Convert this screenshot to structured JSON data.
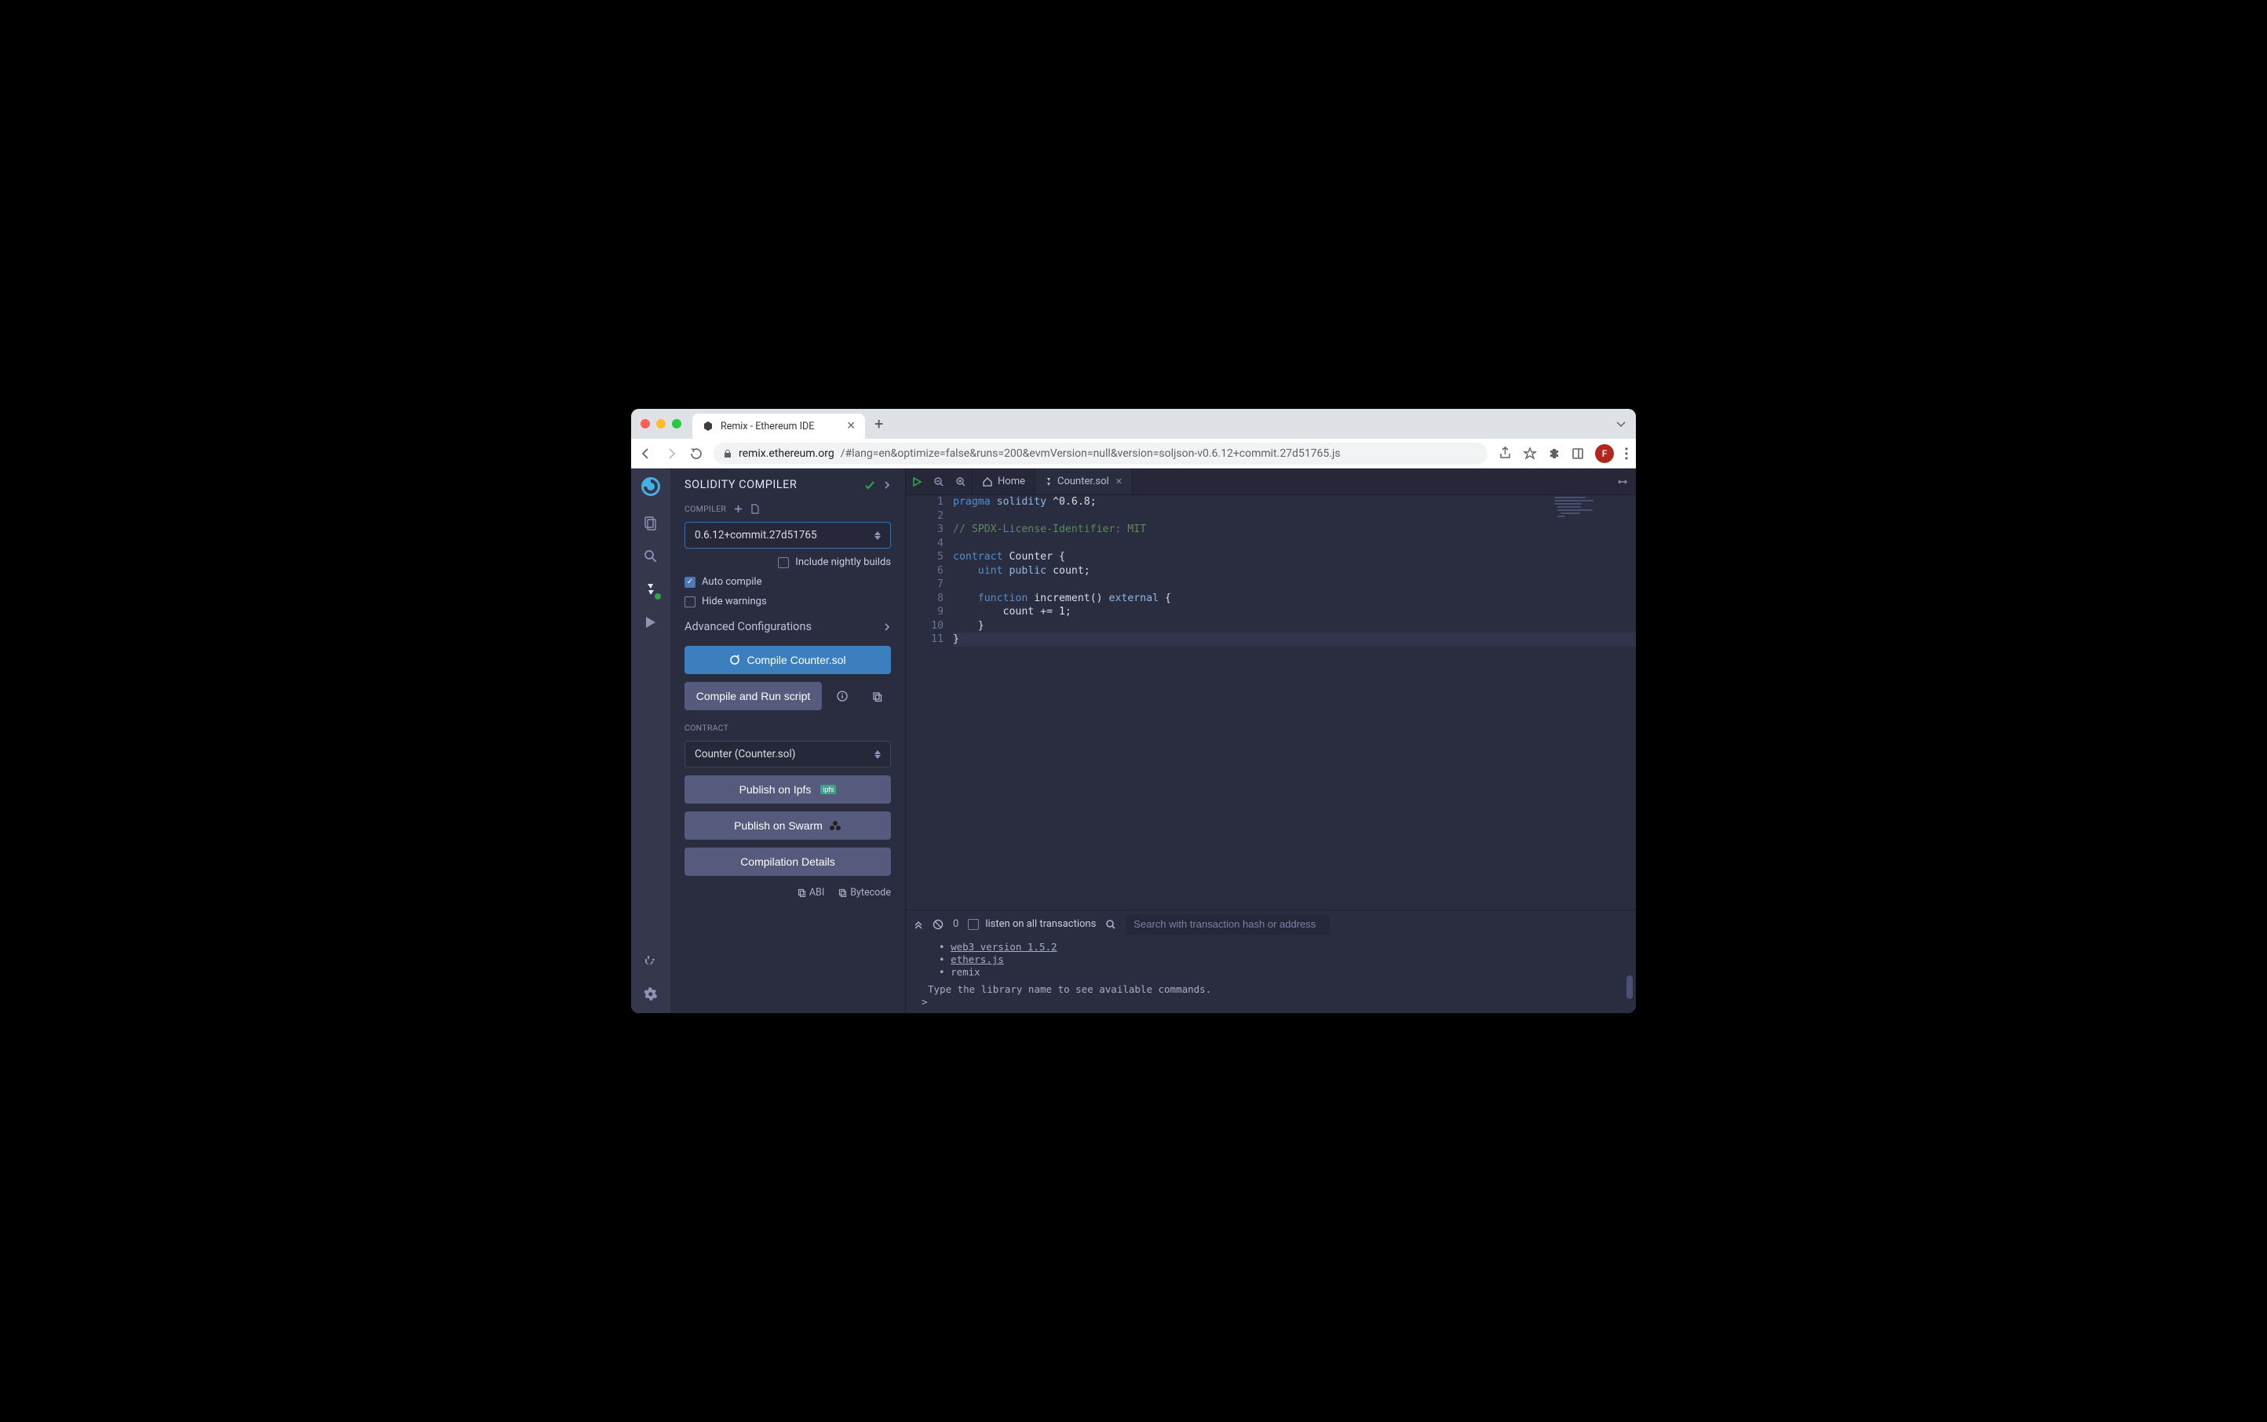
{
  "browser": {
    "tab_title": "Remix - Ethereum IDE",
    "url_host": "remix.ethereum.org",
    "url_path": "/#lang=en&optimize=false&runs=200&evmVersion=null&version=soljson-v0.6.12+commit.27d51765.js",
    "avatar_letter": "F"
  },
  "panel": {
    "title": "SOLIDITY COMPILER",
    "compiler_label": "COMPILER",
    "compiler_value": "0.6.12+commit.27d51765",
    "nightly_label": "Include nightly builds",
    "autocompile_label": "Auto compile",
    "hidewarnings_label": "Hide warnings",
    "adv_label": "Advanced Configurations",
    "compile_btn": "Compile Counter.sol",
    "compile_run_btn": "Compile and Run script",
    "contract_label": "CONTRACT",
    "contract_value": "Counter (Counter.sol)",
    "publish_ipfs": "Publish on Ipfs",
    "publish_swarm": "Publish on Swarm",
    "compilation_details": "Compilation Details",
    "abi_label": "ABI",
    "bytecode_label": "Bytecode",
    "ipfs_badge": "ipfs"
  },
  "editor": {
    "home_tab": "Home",
    "active_tab": "Counter.sol",
    "lines": [
      {
        "n": 1,
        "tokens": [
          {
            "c": "k1",
            "t": "pragma"
          },
          {
            "t": " "
          },
          {
            "c": "k2",
            "t": "solidity"
          },
          {
            "t": " ^0.6.8;"
          }
        ]
      },
      {
        "n": 2,
        "tokens": []
      },
      {
        "n": 3,
        "tokens": [
          {
            "c": "cmt",
            "t": "// SPDX-License-Identifier: MIT"
          }
        ]
      },
      {
        "n": 4,
        "tokens": []
      },
      {
        "n": 5,
        "tokens": [
          {
            "c": "k1",
            "t": "contract"
          },
          {
            "t": " Counter {"
          }
        ]
      },
      {
        "n": 6,
        "tokens": [
          {
            "t": "    "
          },
          {
            "c": "k1",
            "t": "uint"
          },
          {
            "t": " "
          },
          {
            "c": "k2",
            "t": "public"
          },
          {
            "t": " count;"
          }
        ]
      },
      {
        "n": 7,
        "tokens": []
      },
      {
        "n": 8,
        "tokens": [
          {
            "t": "    "
          },
          {
            "c": "k1",
            "t": "function"
          },
          {
            "t": " increment() "
          },
          {
            "c": "k2",
            "t": "external"
          },
          {
            "t": " {"
          }
        ]
      },
      {
        "n": 9,
        "tokens": [
          {
            "t": "        count += 1;"
          }
        ]
      },
      {
        "n": 10,
        "tokens": [
          {
            "t": "    }"
          }
        ]
      },
      {
        "n": 11,
        "hl": true,
        "tokens": [
          {
            "t": "}"
          }
        ]
      }
    ]
  },
  "terminal": {
    "pending_count": "0",
    "listen_label": "listen on all transactions",
    "search_placeholder": "Search with transaction hash or address",
    "items": [
      "web3 version 1.5.2",
      "ethers.js",
      "remix"
    ],
    "hint": "Type the library name to see available commands.",
    "prompt": ">"
  }
}
